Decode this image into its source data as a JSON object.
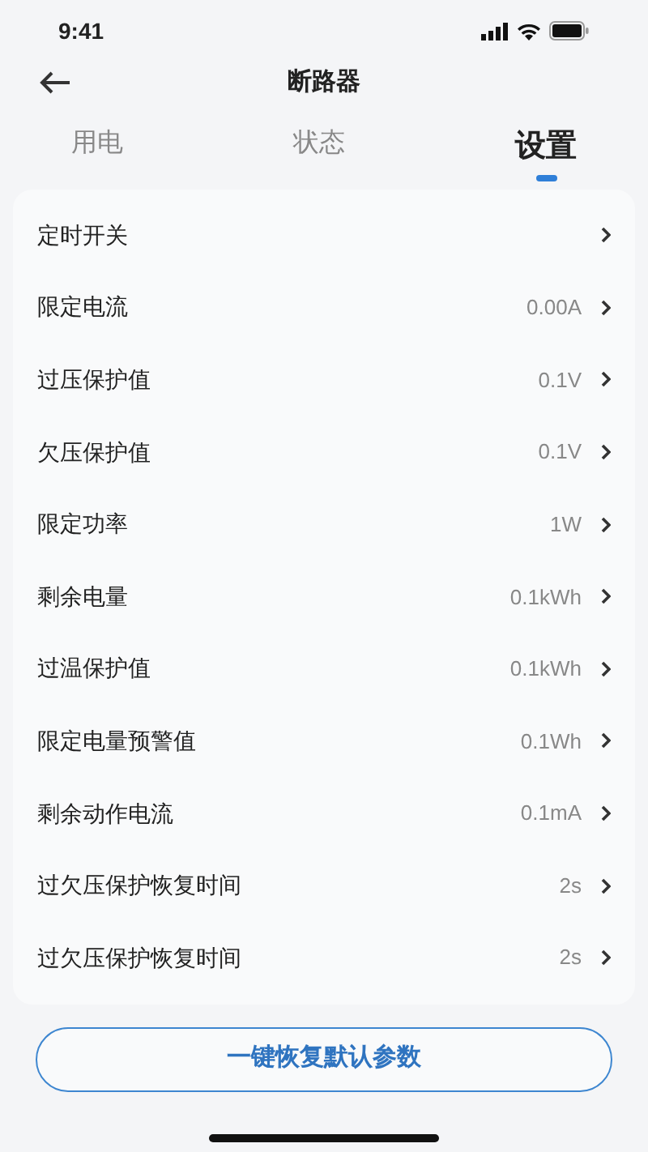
{
  "status_bar": {
    "time": "9:41"
  },
  "header": {
    "title": "断路器"
  },
  "tabs": [
    {
      "label": "用电",
      "selected": false
    },
    {
      "label": "状态",
      "selected": false
    },
    {
      "label": "设置",
      "selected": true
    }
  ],
  "settings": [
    {
      "label": "定时开关"
    },
    {
      "label": "限定电流",
      "value": "0.00A"
    },
    {
      "label": "过压保护值",
      "value": "0.1V"
    },
    {
      "label": "欠压保护值",
      "value": "0.1V"
    },
    {
      "label": "限定功率",
      "value": "1W"
    },
    {
      "label": "剩余电量",
      "value": "0.1kWh"
    },
    {
      "label": "过温保护值",
      "value": "0.1kWh"
    },
    {
      "label": "限定电量预警值",
      "value": "0.1Wh"
    },
    {
      "label": "剩余动作电流",
      "value": "0.1mA"
    },
    {
      "label": "过欠压保护恢复时间",
      "value": "2s"
    },
    {
      "label": "过欠压保护恢复时间",
      "value": "2s"
    }
  ],
  "reset_button": "一键恢复默认参数"
}
